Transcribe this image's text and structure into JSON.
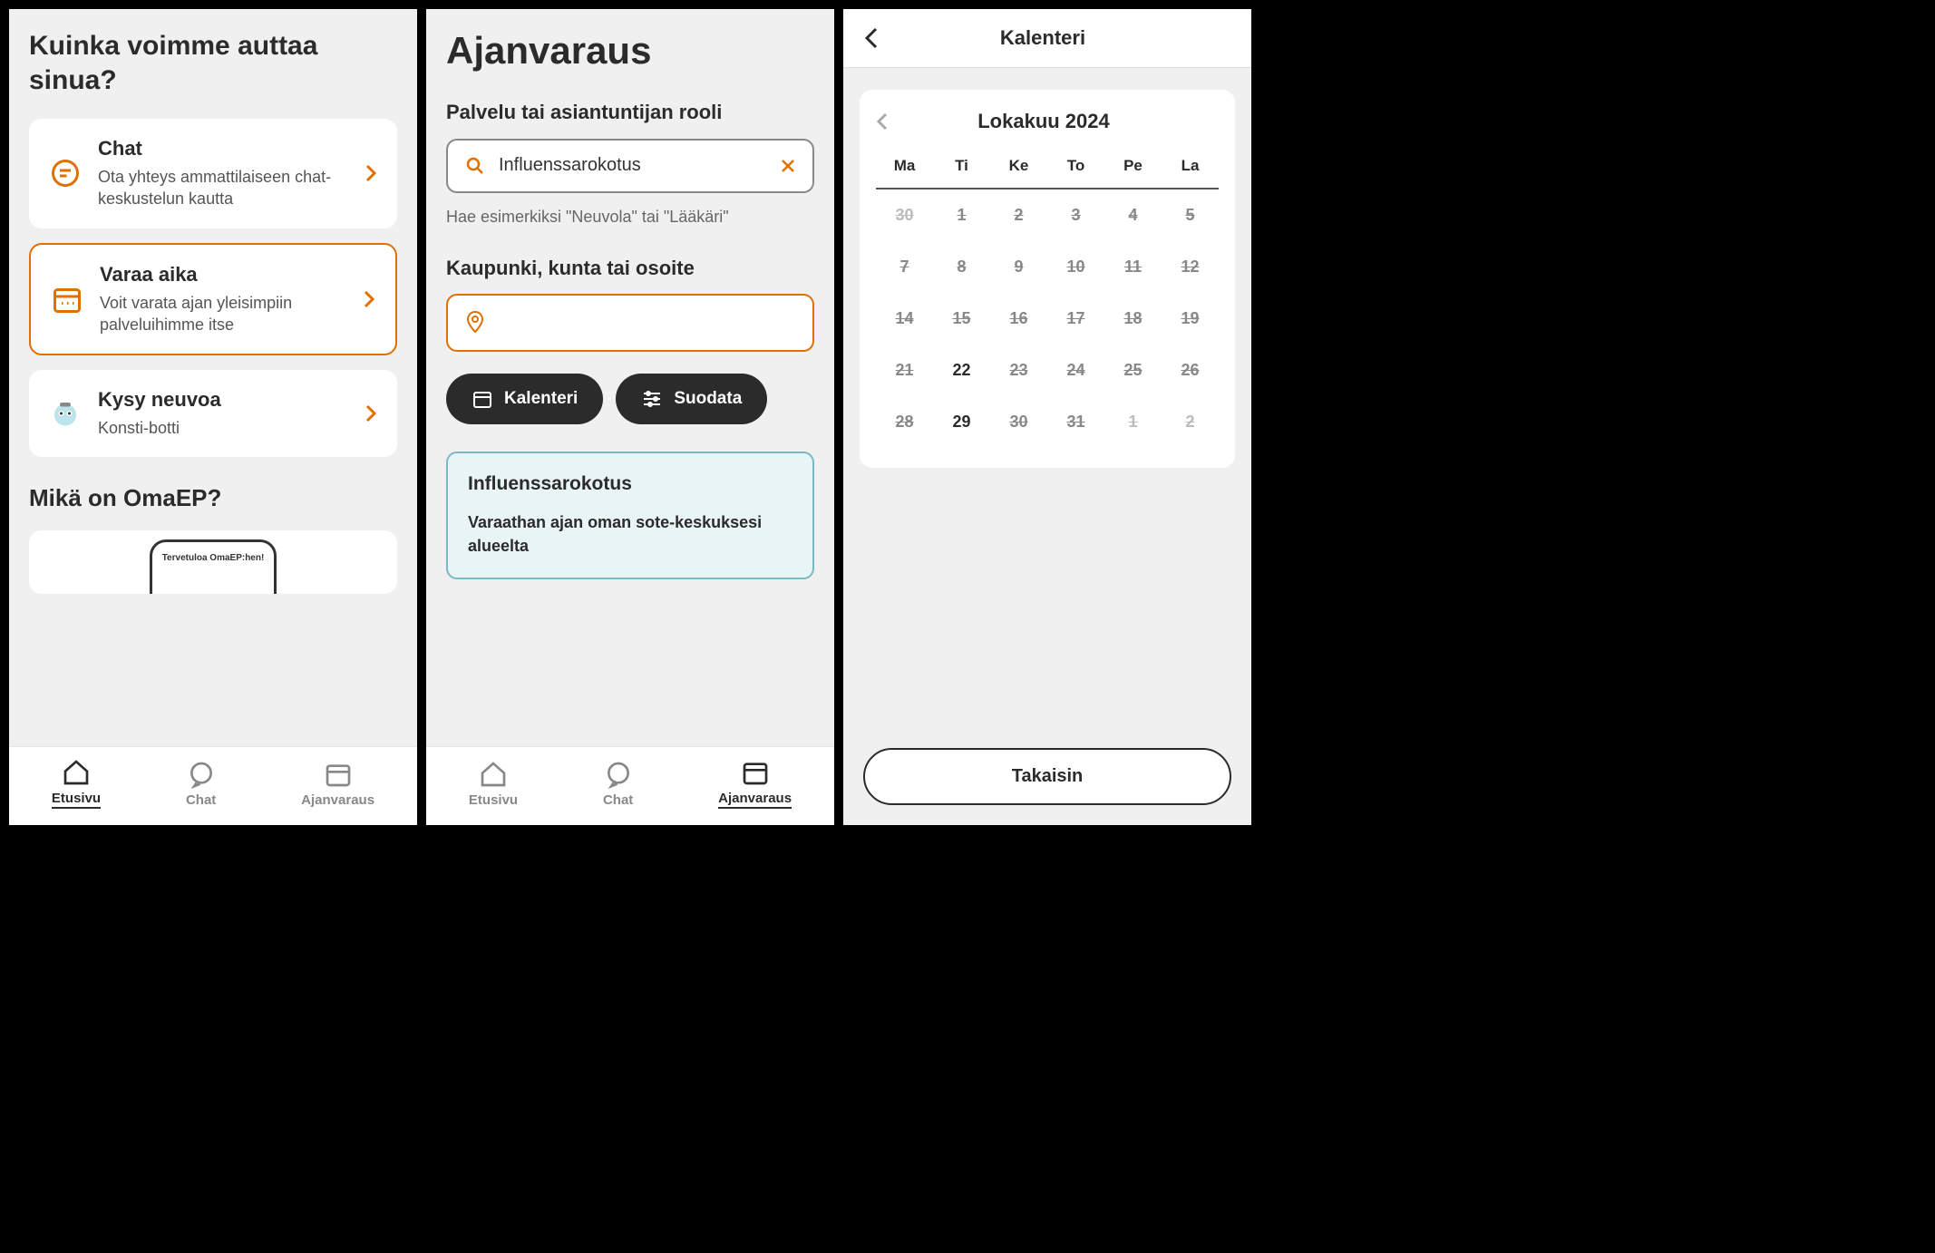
{
  "screen1": {
    "title": "Kuinka voimme auttaa sinua?",
    "cards": [
      {
        "title": "Chat",
        "desc": "Ota yhteys ammattilaiseen chat-keskustelun kautta"
      },
      {
        "title": "Varaa aika",
        "desc": "Voit varata ajan yleisimpiin palveluihimme itse"
      },
      {
        "title": "Kysy neuvoa",
        "desc": "Konsti-botti"
      }
    ],
    "subtitle": "Mikä on OmaEP?",
    "promo_label": "Tervetuloa OmaEP:hen!"
  },
  "nav": {
    "home": "Etusivu",
    "chat": "Chat",
    "booking": "Ajanvaraus"
  },
  "screen2": {
    "title": "Ajanvaraus",
    "service_label": "Palvelu tai asiantuntijan rooli",
    "service_value": "Influenssarokotus",
    "hint": "Hae esimerkiksi \"Neuvola\" tai \"Lääkäri\"",
    "location_label": "Kaupunki, kunta tai osoite",
    "location_value": "",
    "calendar_btn": "Kalenteri",
    "filter_btn": "Suodata",
    "info_title": "Influenssarokotus",
    "info_body": "Varaathan ajan oman sote-keskuksesi alueelta"
  },
  "screen3": {
    "header": "Kalenteri",
    "month": "Lokakuu 2024",
    "day_headers": [
      "Ma",
      "Ti",
      "Ke",
      "To",
      "Pe",
      "La"
    ],
    "rows": [
      [
        {
          "n": "30",
          "kind": "prev"
        },
        {
          "n": "1",
          "kind": "today"
        },
        {
          "n": "2",
          "kind": "strike"
        },
        {
          "n": "3",
          "kind": "strike"
        },
        {
          "n": "4",
          "kind": "strike"
        },
        {
          "n": "5",
          "kind": "strike"
        }
      ],
      [
        {
          "n": "7",
          "kind": "strike"
        },
        {
          "n": "8",
          "kind": "strike"
        },
        {
          "n": "9",
          "kind": "strike"
        },
        {
          "n": "10",
          "kind": "strike"
        },
        {
          "n": "11",
          "kind": "strike"
        },
        {
          "n": "12",
          "kind": "strike"
        }
      ],
      [
        {
          "n": "14",
          "kind": "strike"
        },
        {
          "n": "15",
          "kind": "strike"
        },
        {
          "n": "16",
          "kind": "strike"
        },
        {
          "n": "17",
          "kind": "strike"
        },
        {
          "n": "18",
          "kind": "strike"
        },
        {
          "n": "19",
          "kind": "strike"
        }
      ],
      [
        {
          "n": "21",
          "kind": "strike"
        },
        {
          "n": "22",
          "kind": "available"
        },
        {
          "n": "23",
          "kind": "strike"
        },
        {
          "n": "24",
          "kind": "strike"
        },
        {
          "n": "25",
          "kind": "strike"
        },
        {
          "n": "26",
          "kind": "strike"
        }
      ],
      [
        {
          "n": "28",
          "kind": "strike"
        },
        {
          "n": "29",
          "kind": "available"
        },
        {
          "n": "30",
          "kind": "strike"
        },
        {
          "n": "31",
          "kind": "strike"
        },
        {
          "n": "1",
          "kind": "prev"
        },
        {
          "n": "2",
          "kind": "prev"
        }
      ]
    ],
    "back_btn": "Takaisin"
  },
  "colors": {
    "accent": "#e07000",
    "dark": "#2b2b2b"
  }
}
